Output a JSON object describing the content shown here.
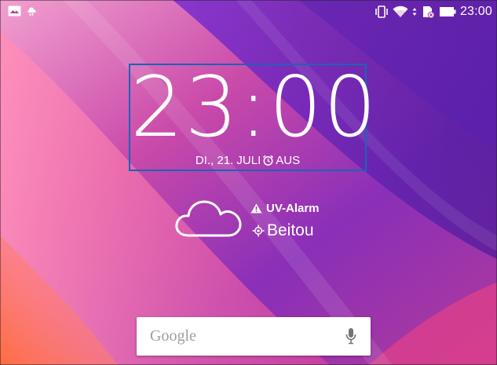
{
  "status_bar": {
    "time": "23:00",
    "left_icons": [
      "photo-notification-icon",
      "weather-notification-icon"
    ],
    "right_icons": [
      "vibrate-icon",
      "wifi-icon",
      "sd-card-icon",
      "battery-icon"
    ]
  },
  "clock": {
    "hour": "23",
    "separator": ":",
    "minute": "00",
    "date": "DI., 21. JULI",
    "alarm_icon": "alarm-clock-icon",
    "alarm_status": "AUS"
  },
  "weather": {
    "icon": "cloud-icon",
    "alert_icon": "warning-icon",
    "alert": "UV-Alarm",
    "location_icon": "location-target-icon",
    "location": "Beitou"
  },
  "search": {
    "label": "Google",
    "mic_icon": "microphone-icon"
  },
  "colors": {
    "focus_border": "#1b63b8",
    "wallpaper_pink": "#e24a9c",
    "wallpaper_purple": "#6a1fb0",
    "wallpaper_orange": "#f0794a"
  }
}
